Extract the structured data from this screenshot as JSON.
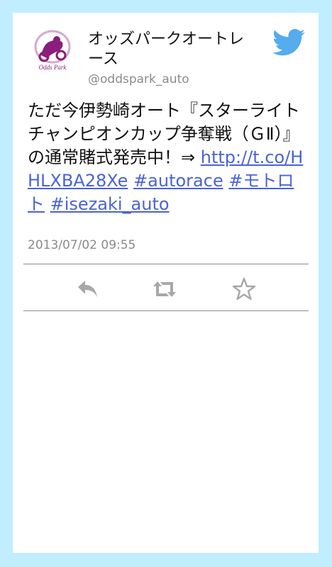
{
  "colors": {
    "background": "#c0eeff",
    "card": "#ffffff",
    "link": "#4a63d6",
    "icon_gray": "#a8a8a8",
    "twitter_blue": "#55acee",
    "brand_purple": "#8b1e7a"
  },
  "tweet": {
    "author": {
      "name": "オッズパークオートレース",
      "handle": "@oddspark_auto",
      "avatar_icon": "oddspark-logo-icon",
      "avatar_text": "Odds Park"
    },
    "text_prefix": "ただ今伊勢崎オート『スターライトチャンピオンカップ争奪戦（ＧⅡ）』の通常賭式発売中！⇒ ",
    "link_url": "http://t.co/HHLXBA28Xe",
    "hashtags": [
      "#autorace",
      "#モトロト",
      "#isezaki_auto"
    ],
    "timestamp": "2013/07/02 09:55"
  },
  "actions": [
    {
      "name": "reply",
      "icon": "reply-icon"
    },
    {
      "name": "retweet",
      "icon": "retweet-icon"
    },
    {
      "name": "favorite",
      "icon": "star-icon"
    }
  ],
  "header_icon": "twitter-bird-icon"
}
